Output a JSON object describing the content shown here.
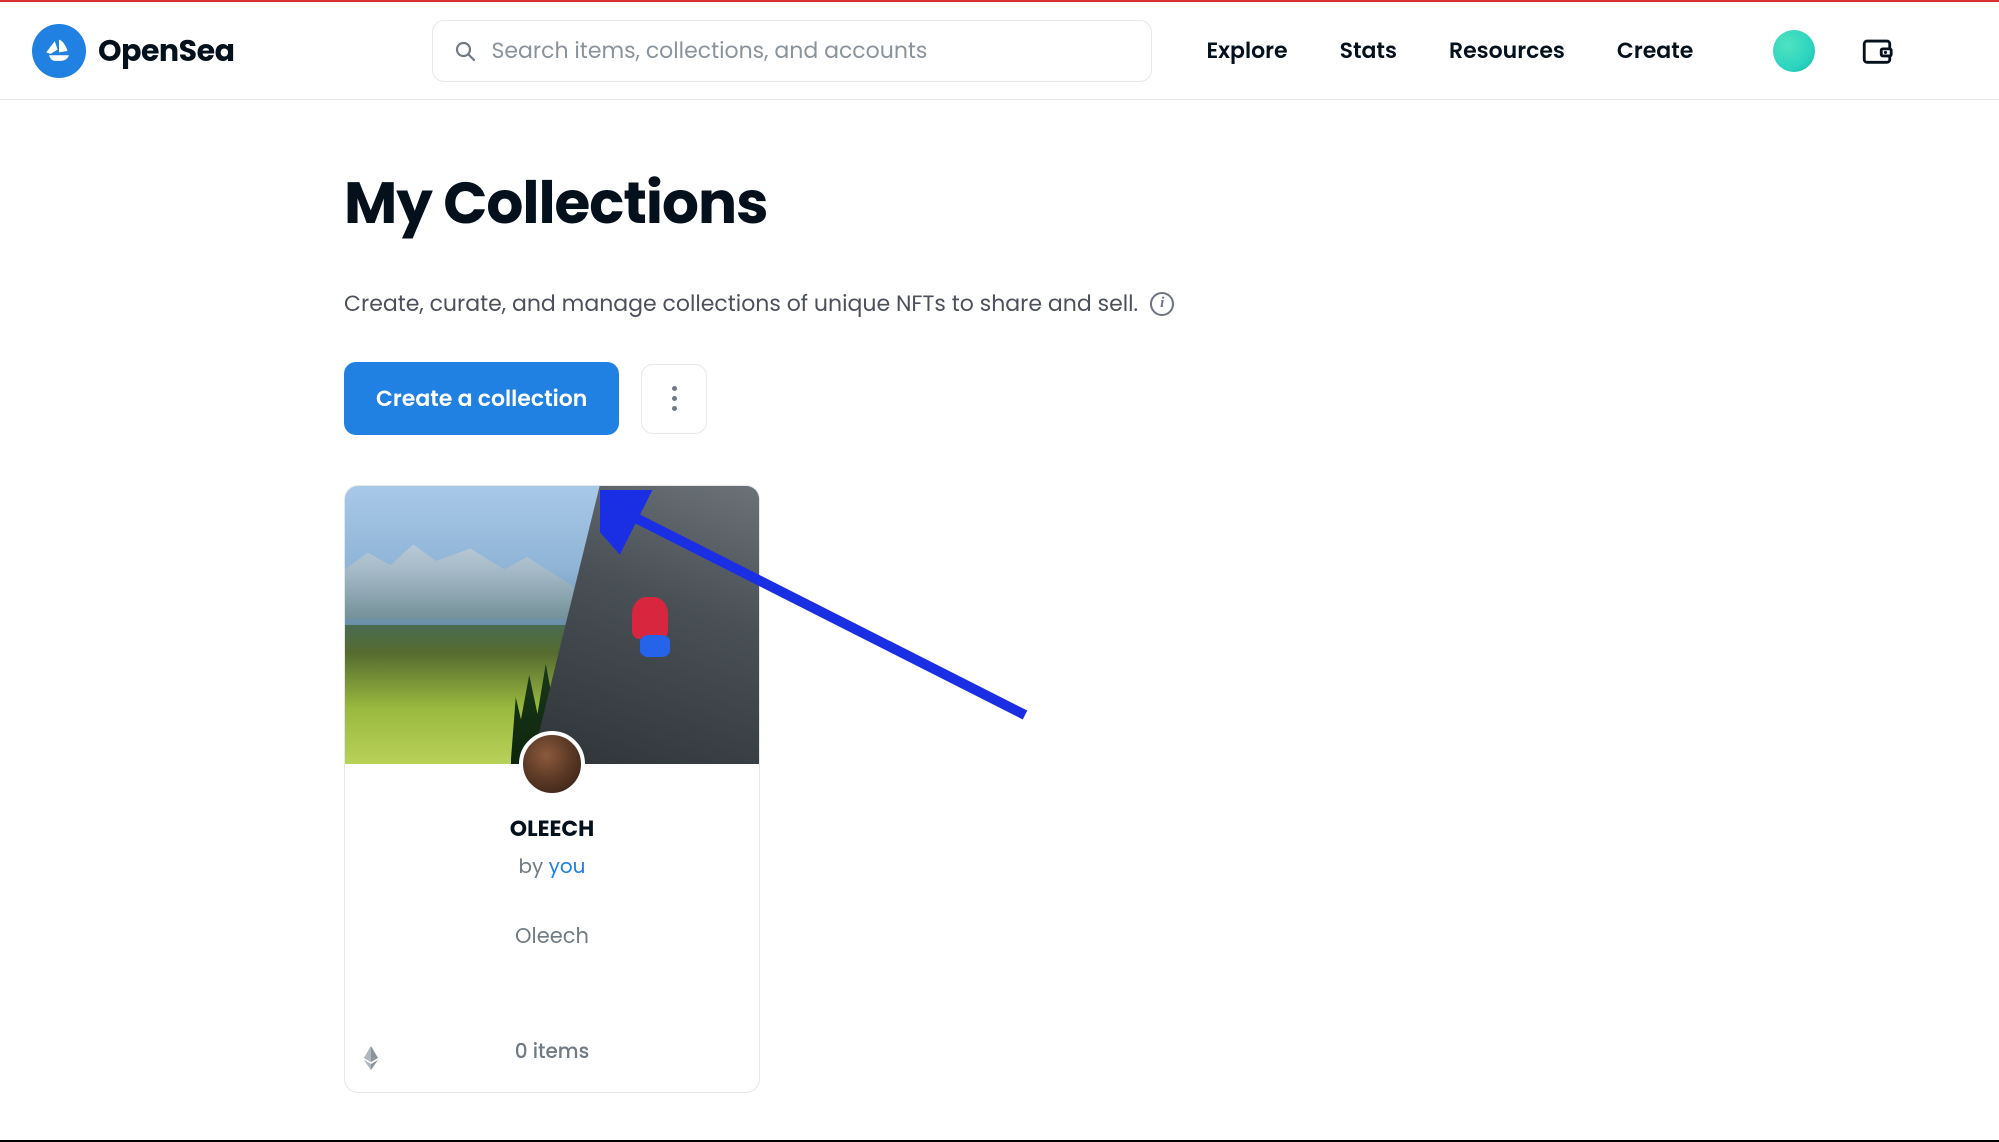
{
  "brand": {
    "name": "OpenSea"
  },
  "search": {
    "placeholder": "Search items, collections, and accounts"
  },
  "nav": {
    "explore": "Explore",
    "stats": "Stats",
    "resources": "Resources",
    "create": "Create"
  },
  "page": {
    "title": "My Collections",
    "subtitle": "Create, curate, and manage collections of unique NFTs to share and sell."
  },
  "actions": {
    "create_collection": "Create a collection"
  },
  "collection_card": {
    "name": "OLEECH",
    "by_label": "by ",
    "by_link": "you",
    "description": "Oleech",
    "item_count": "0 items"
  },
  "colors": {
    "primary": "#2081e2",
    "text": "#04111d",
    "muted": "#707a83",
    "annotation": "#1a2fe3"
  }
}
